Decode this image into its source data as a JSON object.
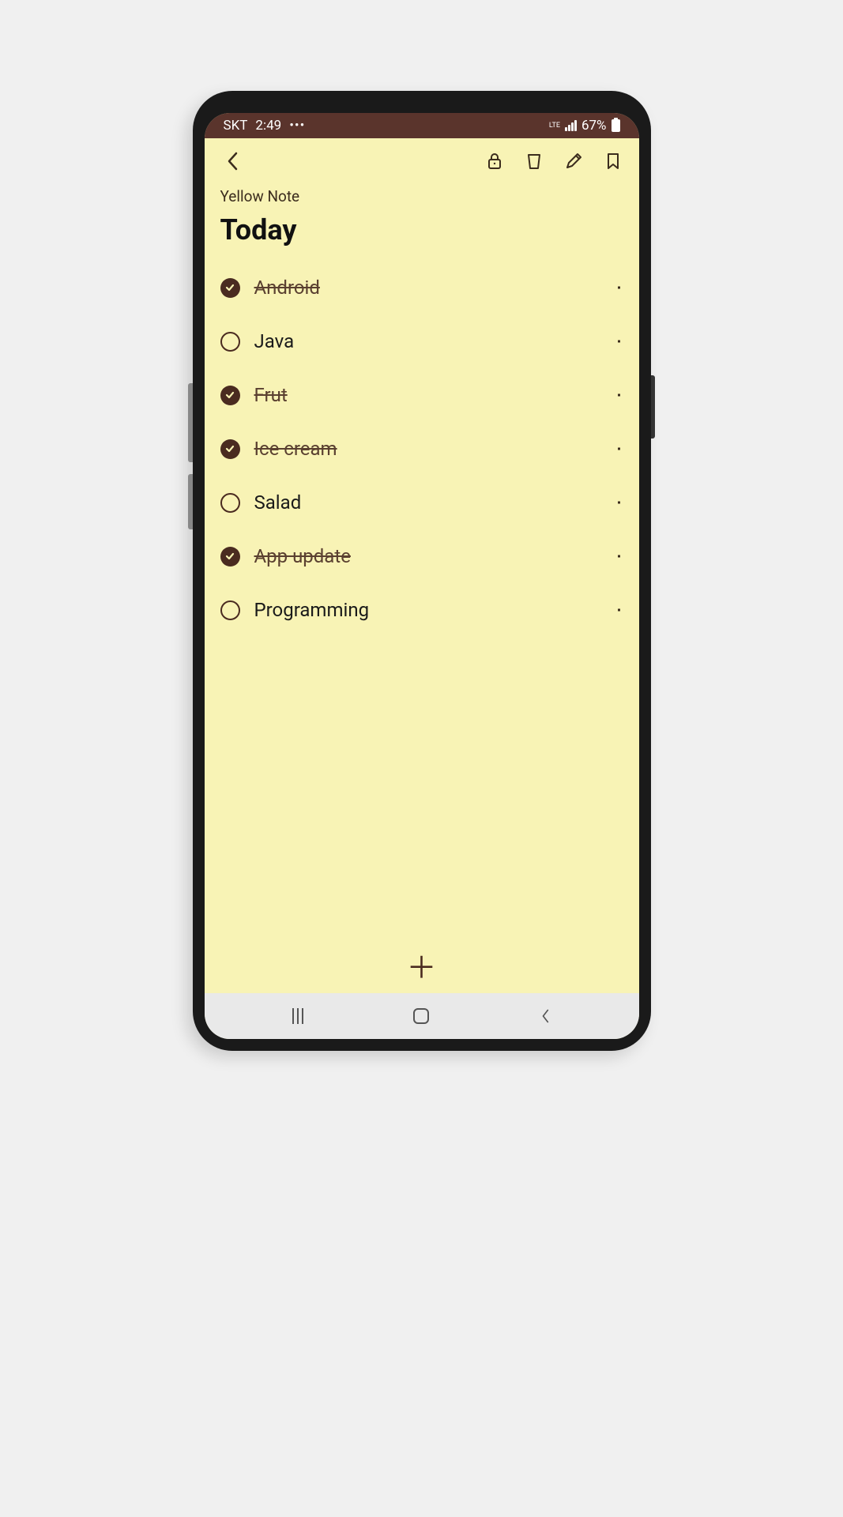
{
  "status_bar": {
    "carrier": "SKT",
    "time": "2:49",
    "network_type": "LTE",
    "battery_percent": "67%"
  },
  "note": {
    "label": "Yellow Note",
    "title": "Today"
  },
  "todos": [
    {
      "text": "Android",
      "checked": true
    },
    {
      "text": "Java",
      "checked": false
    },
    {
      "text": "Frut",
      "checked": true
    },
    {
      "text": "Ice cream",
      "checked": true
    },
    {
      "text": "Salad",
      "checked": false
    },
    {
      "text": "App update",
      "checked": true
    },
    {
      "text": "Programming",
      "checked": false
    }
  ],
  "colors": {
    "note_bg": "#f8f3b5",
    "accent": "#4a2b20",
    "status_bg": "#5a342c"
  }
}
